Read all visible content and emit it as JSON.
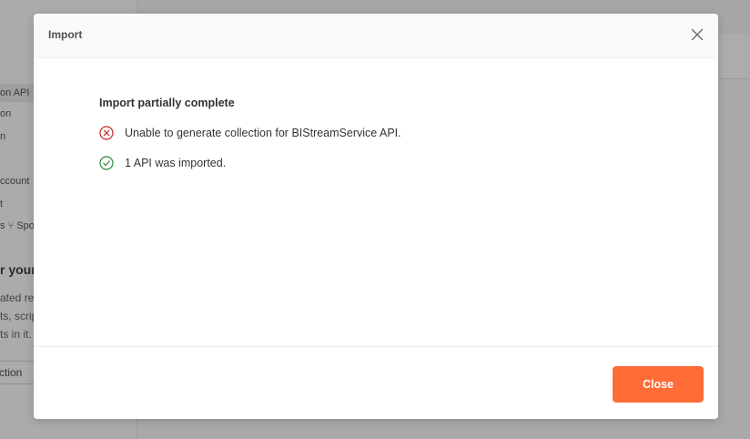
{
  "background": {
    "sidebar_items": [
      "on API",
      "on",
      "n",
      "ccount",
      "t",
      "s",
      "Spo"
    ],
    "heading": "r your",
    "paragraph_lines": [
      "ated rec",
      "ts, scrip",
      "ts in it."
    ],
    "button_label": "ction"
  },
  "modal": {
    "title": "Import",
    "body": {
      "heading": "Import partially complete",
      "results": [
        {
          "status": "error",
          "icon": "error-circle-icon",
          "text": "Unable to generate collection for BIStreamService API."
        },
        {
          "status": "success",
          "icon": "check-circle-icon",
          "text": "1 API was imported."
        }
      ]
    },
    "footer": {
      "close_label": "Close"
    }
  },
  "colors": {
    "accent": "#ff6c37",
    "error": "#c22b2b",
    "success": "#2a8a3e"
  }
}
